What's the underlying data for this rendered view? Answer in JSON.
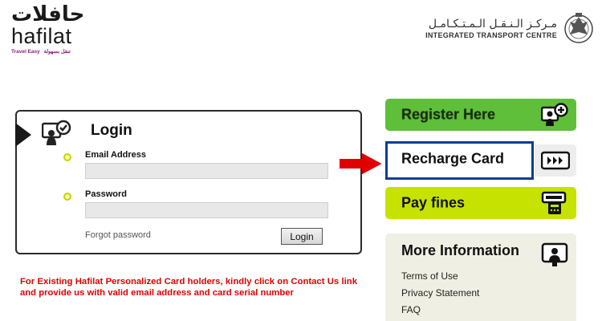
{
  "header": {
    "brand_arabic": "حافلات",
    "brand_latin": "hafilat",
    "brand_tagline_latin": "Travel Easy",
    "brand_tagline_arabic": "تنقل بسهولة",
    "itc_arabic": "مـركـز الـنـقـل الـمـتـكـامـل",
    "itc_english": "INTEGRATED TRANSPORT CENTRE"
  },
  "login": {
    "title": "Login",
    "email_label": "Email Address",
    "email_value": "",
    "password_label": "Password",
    "password_value": "",
    "forgot_label": "Forgot password",
    "submit_label": "Login"
  },
  "notice": "For Existing Hafilat Personalized Card holders, kindly click on Contact Us link and provide us with valid email address and card serial number",
  "side": {
    "register_label": "Register Here",
    "recharge_label": "Recharge Card",
    "payfines_label": "Pay fines",
    "more_info_title": "More Information",
    "links": [
      "Terms of Use",
      "Privacy Statement",
      "FAQ"
    ]
  },
  "colors": {
    "register_green": "#5fbf3a",
    "payfines_lime": "#c6e200",
    "highlight_blue": "#0b3d91",
    "arrow_red": "#e00000",
    "notice_red": "#e00000",
    "more_info_bg": "#efefe4"
  },
  "icons": {
    "login": "user-check-icon",
    "register": "user-plus-icon",
    "recharge": "card-forward-icon",
    "payfines": "card-terminal-icon",
    "more_info": "user-screen-icon"
  }
}
